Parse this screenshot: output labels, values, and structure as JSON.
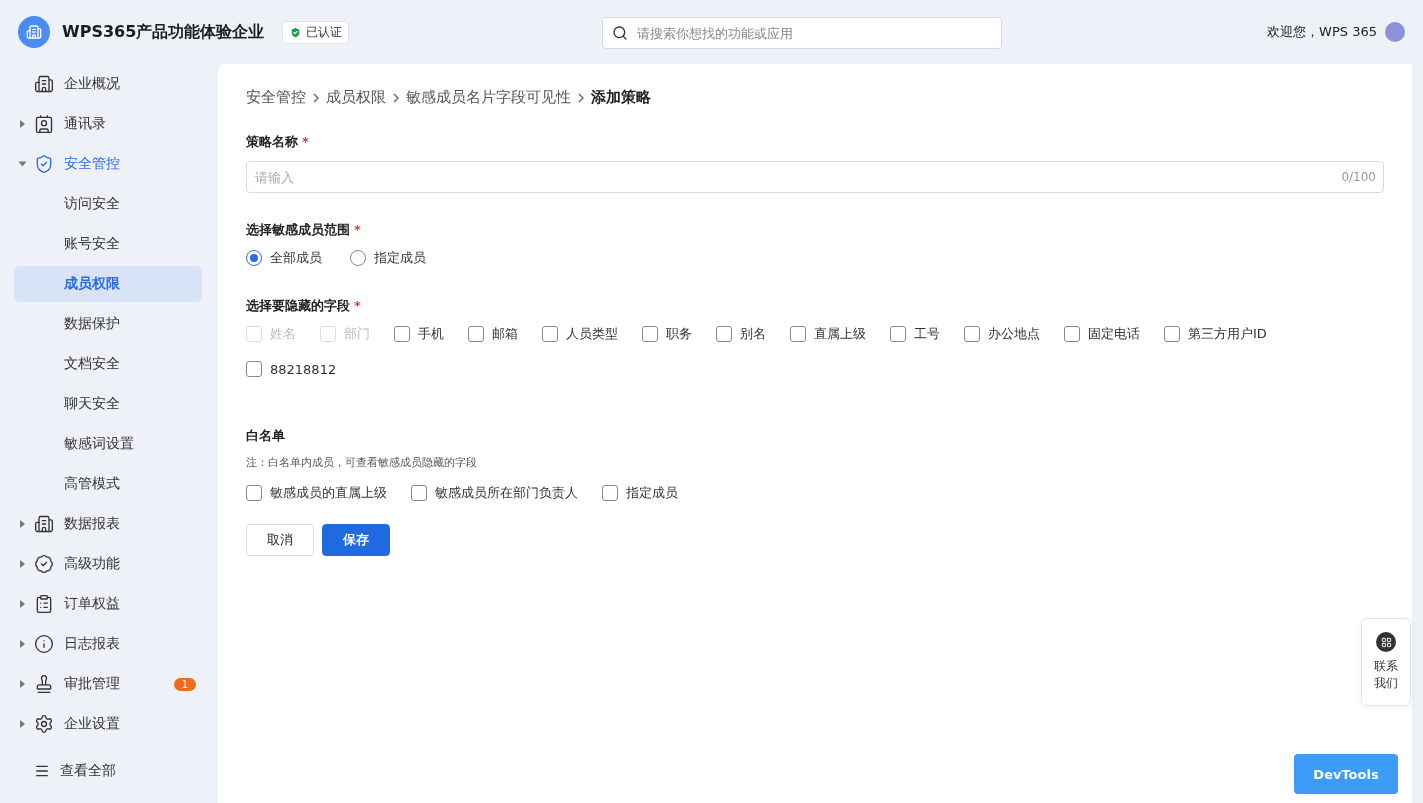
{
  "header": {
    "org_name": "WPS365产品功能体验企业",
    "verified_badge": "已认证",
    "search": {
      "placeholder": "请搜索你想找的功能或应用"
    },
    "welcome": "欢迎您，WPS 365"
  },
  "sidebar": {
    "items": [
      {
        "label": "企业概况",
        "expandable": false,
        "selected": false
      },
      {
        "label": "通讯录",
        "expandable": true,
        "expanded": false,
        "selected": false
      },
      {
        "label": "安全管控",
        "expandable": true,
        "expanded": true,
        "selected": true,
        "children": [
          {
            "label": "访问安全",
            "selected": false
          },
          {
            "label": "账号安全",
            "selected": false
          },
          {
            "label": "成员权限",
            "selected": true
          },
          {
            "label": "数据保护",
            "selected": false
          },
          {
            "label": "文档安全",
            "selected": false
          },
          {
            "label": "聊天安全",
            "selected": false
          },
          {
            "label": "敏感词设置",
            "selected": false
          },
          {
            "label": "高管模式",
            "selected": false
          }
        ]
      },
      {
        "label": "数据报表",
        "expandable": true,
        "expanded": false,
        "selected": false
      },
      {
        "label": "高级功能",
        "expandable": true,
        "expanded": false,
        "selected": false
      },
      {
        "label": "订单权益",
        "expandable": true,
        "expanded": false,
        "selected": false
      },
      {
        "label": "日志报表",
        "expandable": true,
        "expanded": false,
        "selected": false
      },
      {
        "label": "审批管理",
        "expandable": true,
        "expanded": false,
        "selected": false,
        "badge": "1"
      },
      {
        "label": "企业设置",
        "expandable": true,
        "expanded": false,
        "selected": false
      }
    ],
    "view_all": "查看全部"
  },
  "breadcrumb": [
    "安全管控",
    "成员权限",
    "敏感成员名片字段可见性",
    "添加策略"
  ],
  "form": {
    "name_field": {
      "label": "策略名称",
      "required": "*",
      "placeholder": "请输入",
      "counter": "0/100"
    },
    "scope": {
      "label": "选择敏感成员范围",
      "required": "*",
      "options": [
        {
          "label": "全部成员",
          "selected": true
        },
        {
          "label": "指定成员",
          "selected": false
        }
      ]
    },
    "hidden_fields": {
      "label": "选择要隐藏的字段",
      "required": "*",
      "options": [
        {
          "label": "姓名",
          "checked": false,
          "disabled": true
        },
        {
          "label": "部门",
          "checked": false,
          "disabled": true
        },
        {
          "label": "手机",
          "checked": false,
          "disabled": false
        },
        {
          "label": "邮箱",
          "checked": false,
          "disabled": false
        },
        {
          "label": "人员类型",
          "checked": false,
          "disabled": false
        },
        {
          "label": "职务",
          "checked": false,
          "disabled": false
        },
        {
          "label": "别名",
          "checked": false,
          "disabled": false
        },
        {
          "label": "直属上级",
          "checked": false,
          "disabled": false
        },
        {
          "label": "工号",
          "checked": false,
          "disabled": false
        },
        {
          "label": "办公地点",
          "checked": false,
          "disabled": false
        },
        {
          "label": "固定电话",
          "checked": false,
          "disabled": false
        },
        {
          "label": "第三方用户ID",
          "checked": false,
          "disabled": false
        },
        {
          "label": "88218812",
          "checked": false,
          "disabled": false
        }
      ]
    },
    "whitelist": {
      "label": "白名单",
      "note": "注：白名单内成员，可查看敏感成员隐藏的字段",
      "options": [
        {
          "label": "敏感成员的直属上级",
          "checked": false
        },
        {
          "label": "敏感成员所在部门负责人",
          "checked": false
        },
        {
          "label": "指定成员",
          "checked": false
        }
      ]
    },
    "buttons": [
      {
        "label": "取消",
        "kind": "secondary"
      },
      {
        "label": "保存",
        "kind": "primary"
      }
    ]
  },
  "contact_button": [
    "联系",
    "我们"
  ],
  "devtools_button": "DevTools"
}
